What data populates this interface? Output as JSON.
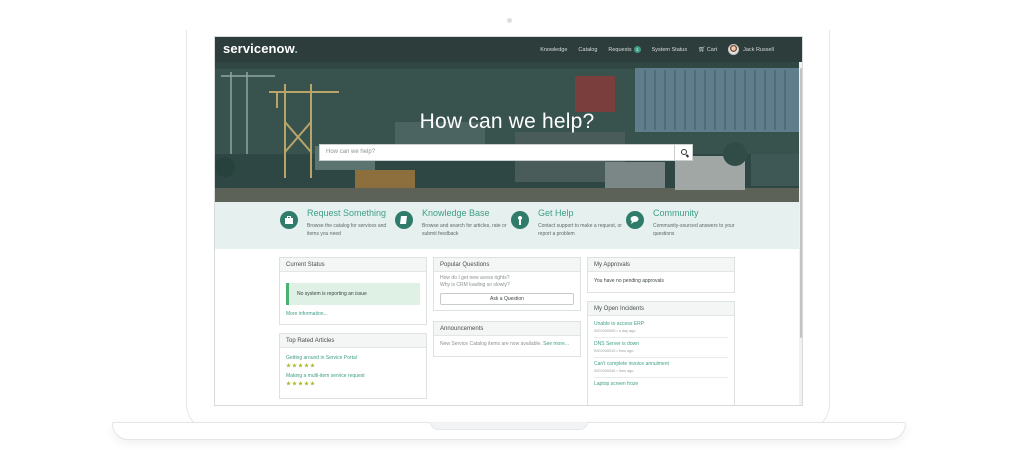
{
  "app": {
    "logo_main": "servicenow",
    "logo_accent": "."
  },
  "nav": {
    "items": [
      {
        "label": "Knowledge"
      },
      {
        "label": "Catalog"
      },
      {
        "label": "Requests",
        "badge": "1"
      },
      {
        "label": "System Status"
      },
      {
        "label": "Cart",
        "icon": "cart-icon"
      }
    ],
    "user": {
      "name": "Jack Russell"
    }
  },
  "hero": {
    "title": "How can we help?",
    "search_placeholder": "How can we help?",
    "search_icon": "search-icon"
  },
  "quick_actions": [
    {
      "title": "Request Something",
      "desc": "Browse the catalog for services and items you need",
      "icon": "briefcase-icon"
    },
    {
      "title": "Knowledge Base",
      "desc": "Browse and search for articles, rate or submit feedback",
      "icon": "book-icon"
    },
    {
      "title": "Get Help",
      "desc": "Contact support to make a request, or report a problem",
      "icon": "lifebuoy-icon"
    },
    {
      "title": "Community",
      "desc": "Community-sourced answers to your questions",
      "icon": "chat-icon"
    }
  ],
  "current_status": {
    "title": "Current Status",
    "message": "No system is reporting an issue",
    "more_link": "More information..."
  },
  "top_rated": {
    "title": "Top Rated Articles",
    "articles": [
      {
        "title": "Getting around in Service Portal",
        "rating": 5
      },
      {
        "title": "Making a multi-item service request",
        "rating": 5
      }
    ]
  },
  "popular_questions": {
    "title": "Popular Questions",
    "questions": [
      "How do I get new acess rights?",
      "Why is CRM loading so slowly?"
    ],
    "ask_button": "Ask a Question"
  },
  "announcements": {
    "title": "Announcements",
    "text": "New Service Catalog items are now available.",
    "link": "See more..."
  },
  "approvals": {
    "title": "My Approvals",
    "text": "You have no pending approvals"
  },
  "open_incidents": {
    "title": "My Open Incidents",
    "items": [
      {
        "title": "Unable to access ERP",
        "meta": "INC0000000 • a day ago"
      },
      {
        "title": "DNS Server is down",
        "meta": "INC0000010 • 5mo ago"
      },
      {
        "title": "Can't complete invoice annulment",
        "meta": "INC0000040 • 5mo ago"
      },
      {
        "title": "Laptop screen froze",
        "meta": ""
      }
    ]
  },
  "colors": {
    "nav_bg": "#2d3d3b",
    "accent": "#3f9e86",
    "hero_bg": "#37504c",
    "actions_band": "#e6f1ef"
  }
}
